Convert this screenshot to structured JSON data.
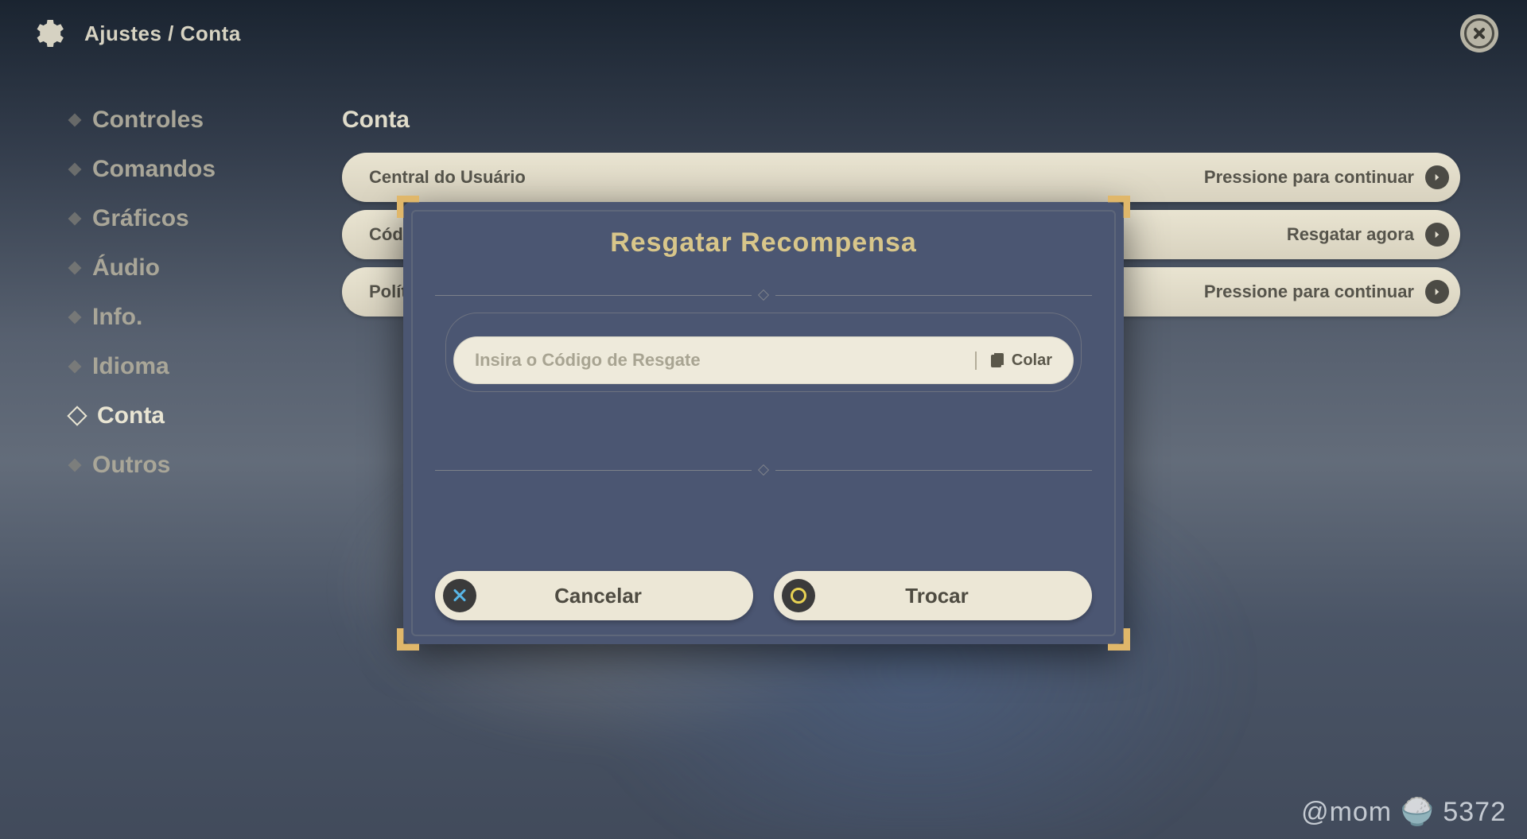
{
  "header": {
    "breadcrumb_settings": "Ajustes",
    "breadcrumb_sep": "/",
    "breadcrumb_section": "Conta"
  },
  "sidebar": {
    "items": [
      {
        "label": "Controles",
        "active": false
      },
      {
        "label": "Comandos",
        "active": false
      },
      {
        "label": "Gráficos",
        "active": false
      },
      {
        "label": "Áudio",
        "active": false
      },
      {
        "label": "Info.",
        "active": false
      },
      {
        "label": "Idioma",
        "active": false
      },
      {
        "label": "Conta",
        "active": true
      },
      {
        "label": "Outros",
        "active": false
      }
    ]
  },
  "main": {
    "section_title": "Conta",
    "rows": [
      {
        "label": "Central do Usuário",
        "action": "Pressione para continuar"
      },
      {
        "label": "Código de Resgate",
        "action": "Resgatar agora"
      },
      {
        "label": "Política de Privacidade",
        "action": "Pressione para continuar"
      }
    ]
  },
  "dialog": {
    "title": "Resgatar Recompensa",
    "input_placeholder": "Insira o Código de Resgate",
    "input_value": "",
    "paste_label": "Colar",
    "cancel_label": "Cancelar",
    "confirm_label": "Trocar"
  },
  "watermark": "@mom 🍚 5372"
}
